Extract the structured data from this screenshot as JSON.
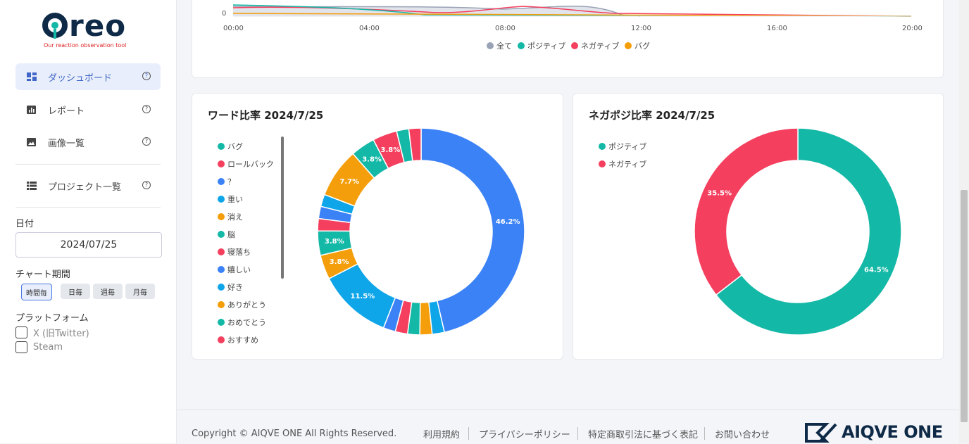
{
  "brand": {
    "logo_word": "Oreo",
    "tagline": "Our reaction observation tool"
  },
  "sidebar": {
    "items": [
      {
        "label": "ダッシュボード",
        "icon": "dashboard-icon",
        "active": true
      },
      {
        "label": "レポート",
        "icon": "report-icon"
      },
      {
        "label": "画像一覧",
        "icon": "image-icon"
      }
    ],
    "project_item": {
      "label": "プロジェクト一覧",
      "icon": "list-icon"
    },
    "help_glyph": "?",
    "date_label": "日付",
    "date_value": "2024/07/25",
    "period_label": "チャート期間",
    "periods": [
      "時間毎",
      "日毎",
      "週毎",
      "月毎"
    ],
    "selected_period": "時間毎",
    "platform_label": "プラットフォーム",
    "platforms": [
      "X (旧Twitter)",
      "Steam"
    ]
  },
  "line_chart": {
    "y_tick": "0",
    "x_ticks": [
      "00:00",
      "04:00",
      "08:00",
      "12:00",
      "16:00",
      "20:00"
    ],
    "legend": [
      {
        "name": "全て",
        "color": "#9aa3b5"
      },
      {
        "name": "ポジティブ",
        "color": "#14b8a6"
      },
      {
        "name": "ネガティブ",
        "color": "#f43f5e"
      },
      {
        "name": "バグ",
        "color": "#f59e0b"
      }
    ]
  },
  "word_ratio": {
    "title": "ワード比率 2024/7/25",
    "legend": [
      {
        "name": "バグ",
        "color": "#14b8a6"
      },
      {
        "name": "ロールバック",
        "color": "#f43f5e"
      },
      {
        "name": "？",
        "color": "#3b82f6"
      },
      {
        "name": "重い",
        "color": "#0ea5e9"
      },
      {
        "name": "消え",
        "color": "#f59e0b"
      },
      {
        "name": "脳",
        "color": "#14b8a6"
      },
      {
        "name": "寝落ち",
        "color": "#f43f5e"
      },
      {
        "name": "嬉しい",
        "color": "#3b82f6"
      },
      {
        "name": "好き",
        "color": "#0ea5e9"
      },
      {
        "name": "ありがとう",
        "color": "#f59e0b"
      },
      {
        "name": "おめでとう",
        "color": "#14b8a6"
      },
      {
        "name": "おすすめ",
        "color": "#f43f5e"
      }
    ]
  },
  "negaposi_ratio": {
    "title": "ネガポジ比率 2024/7/25",
    "legend": [
      {
        "name": "ポジティブ",
        "color": "#14b8a6"
      },
      {
        "name": "ネガティブ",
        "color": "#f43f5e"
      }
    ]
  },
  "chart_data": [
    {
      "type": "pie",
      "title": "ワード比率 2024/7/25",
      "slices": [
        {
          "value": 46.2,
          "color": "#3b82f6",
          "label": "46.2%"
        },
        {
          "value": 1.9,
          "color": "#0ea5e9",
          "label": ""
        },
        {
          "value": 1.9,
          "color": "#f59e0b",
          "label": ""
        },
        {
          "value": 1.9,
          "color": "#14b8a6",
          "label": ""
        },
        {
          "value": 1.9,
          "color": "#f43f5e",
          "label": ""
        },
        {
          "value": 1.9,
          "color": "#3b82f6",
          "label": ""
        },
        {
          "value": 11.5,
          "color": "#0ea5e9",
          "label": "11.5%"
        },
        {
          "value": 3.8,
          "color": "#f59e0b",
          "label": "3.8%"
        },
        {
          "value": 3.8,
          "color": "#14b8a6",
          "label": "3.8%"
        },
        {
          "value": 1.9,
          "color": "#f43f5e",
          "label": ""
        },
        {
          "value": 1.9,
          "color": "#3b82f6",
          "label": ""
        },
        {
          "value": 1.9,
          "color": "#0ea5e9",
          "label": ""
        },
        {
          "value": 7.7,
          "color": "#f59e0b",
          "label": "7.7%"
        },
        {
          "value": 3.8,
          "color": "#14b8a6",
          "label": "3.8%"
        },
        {
          "value": 3.8,
          "color": "#f43f5e",
          "label": "3.8%"
        },
        {
          "value": 1.9,
          "color": "#14b8a6",
          "label": ""
        },
        {
          "value": 1.9,
          "color": "#f43f5e",
          "label": ""
        }
      ]
    },
    {
      "type": "pie",
      "title": "ネガポジ比率 2024/7/25",
      "slices": [
        {
          "value": 64.5,
          "color": "#14b8a6",
          "label": "64.5%"
        },
        {
          "value": 35.5,
          "color": "#f43f5e",
          "label": "35.5%"
        }
      ]
    }
  ],
  "footer": {
    "copyright": "Copyright © AIQVE ONE All Rights Reserved.",
    "links": [
      "利用規約",
      "プライバシーポリシー",
      "特定商取引法に基づく表記",
      "お問い合わせ"
    ],
    "brand": "AIQVE ONE"
  }
}
